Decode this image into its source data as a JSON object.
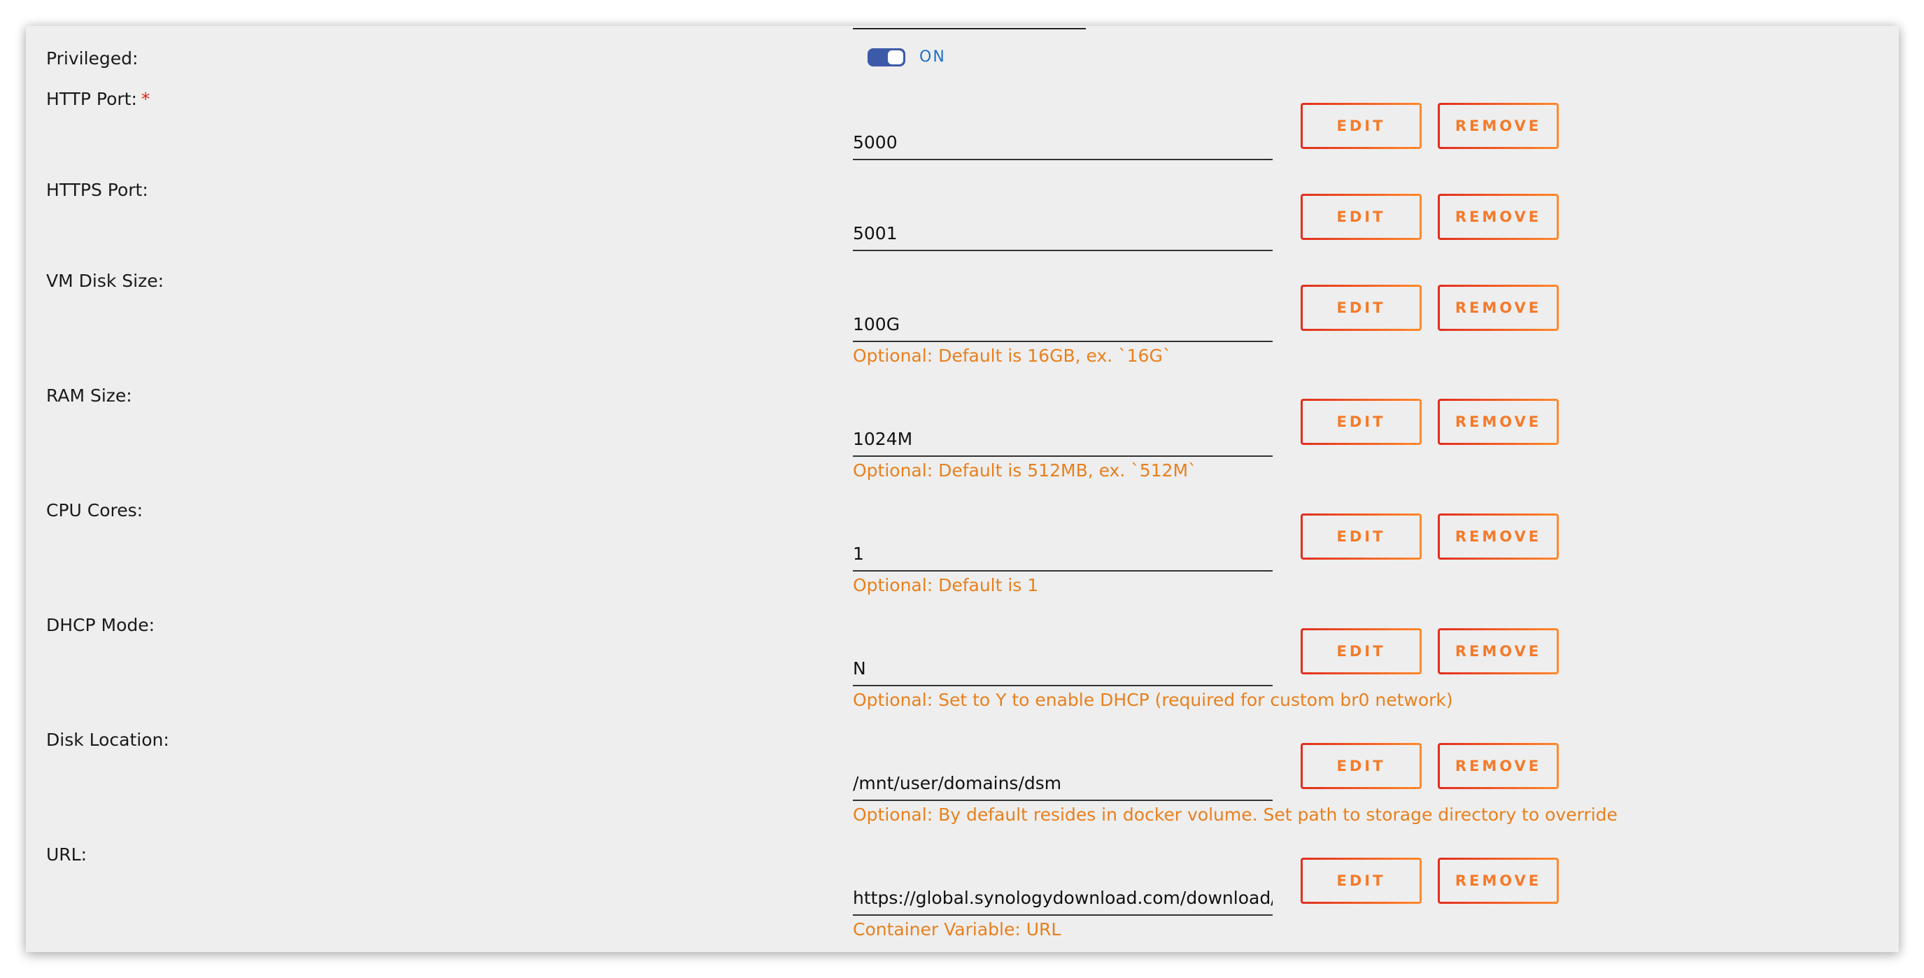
{
  "privileged": {
    "label": "Privileged:",
    "toggle_state": "ON"
  },
  "rows": [
    {
      "label": "HTTP Port:",
      "required_marker": "*",
      "value": "5000",
      "hint": ""
    },
    {
      "label": "HTTPS Port:",
      "value": "5001",
      "hint": ""
    },
    {
      "label": "VM Disk Size:",
      "value": "100G",
      "hint": "Optional: Default is 16GB, ex. `16G`"
    },
    {
      "label": "RAM Size:",
      "value": "1024M",
      "hint": "Optional: Default is 512MB, ex. `512M`"
    },
    {
      "label": "CPU Cores:",
      "value": "1",
      "hint": "Optional: Default is 1"
    },
    {
      "label": "DHCP Mode:",
      "value": "N",
      "hint": "Optional: Set to Y to enable DHCP (required for custom br0 network)"
    },
    {
      "label": "Disk Location:",
      "value": "/mnt/user/domains/dsm",
      "hint": "Optional: By default resides in docker volume. Set path to storage directory to override"
    },
    {
      "label": "URL:",
      "value": "https://global.synologydownload.com/download/D",
      "hint": "Container Variable: URL"
    }
  ],
  "buttons": {
    "edit_label": "EDIT",
    "remove_label": "REMOVE"
  },
  "colors": {
    "panel_background": "#eeeeee",
    "accent_orange": "#f47a2a",
    "accent_red": "#e22d1f",
    "toggle_blue": "#3d5aa8",
    "toggle_text_blue": "#1f6fc4",
    "hint_orange": "#e8801e",
    "required_red": "#e0251b"
  }
}
